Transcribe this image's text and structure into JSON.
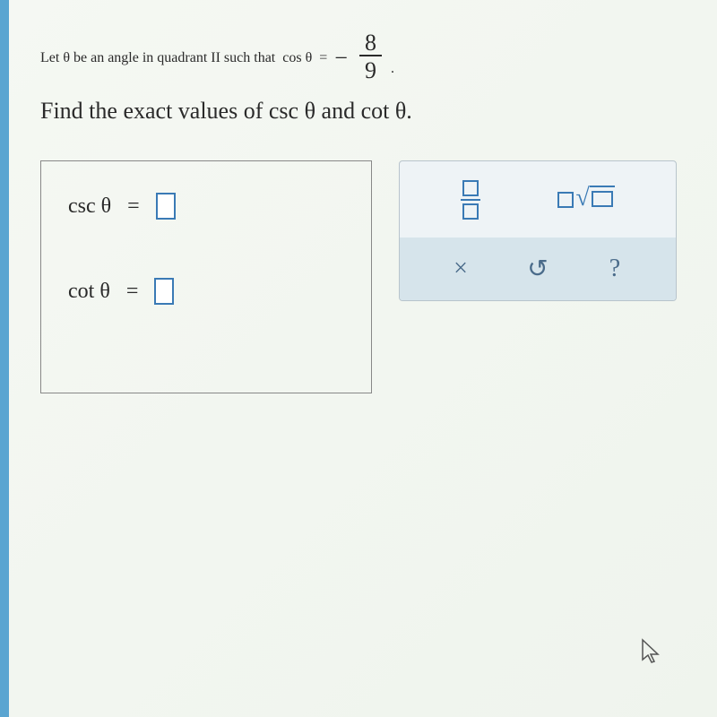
{
  "problem": {
    "line1_prefix": "Let θ be an angle in quadrant II such that",
    "cos_label": "cos θ",
    "equals": "=",
    "minus": "−",
    "frac_num": "8",
    "frac_den": "9",
    "period": ".",
    "line2": "Find the exact values of csc θ and cot θ."
  },
  "answers": {
    "csc_label": "csc θ",
    "cot_label": "cot θ",
    "equals": "="
  },
  "toolbar": {
    "x_label": "×",
    "undo_label": "↺",
    "help_label": "?"
  },
  "chart_data": {
    "type": "math-problem",
    "given": {
      "cos_theta": "-8/9",
      "quadrant": "II"
    },
    "find": [
      "csc θ",
      "cot θ"
    ],
    "inputs": {
      "csc_theta": "",
      "cot_theta": ""
    }
  }
}
